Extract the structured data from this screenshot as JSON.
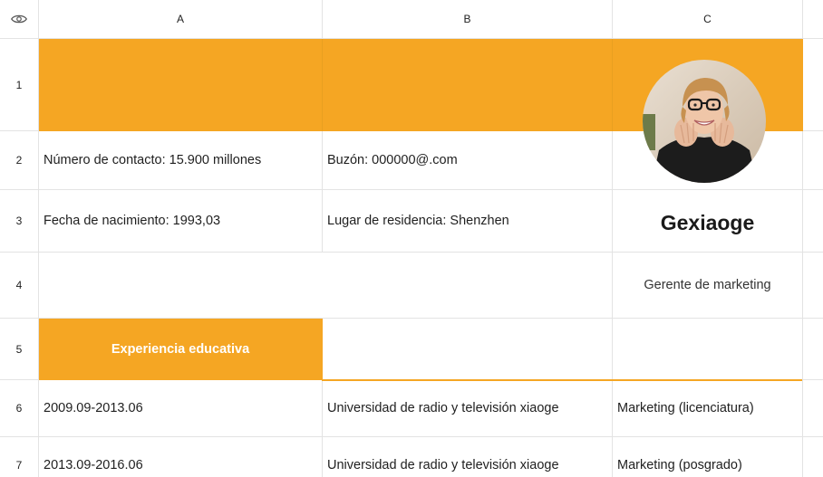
{
  "columns": [
    "A",
    "B",
    "C"
  ],
  "rows": [
    "1",
    "2",
    "3",
    "4",
    "5",
    "6",
    "7"
  ],
  "icons": {
    "visibility": "eye-icon"
  },
  "colors": {
    "accent": "#f5a623"
  },
  "cells": {
    "A2": "Número de contacto: 15.900 millones",
    "B2": "Buzón: 000000@.com",
    "A3": "Fecha de nacimiento: 1993,03",
    "B3": "Lugar de residencia: Shenzhen",
    "C3": "Gexiaoge",
    "C4": "Gerente de marketing",
    "A5": "Experiencia educativa",
    "A6": "2009.09-2013.06",
    "B6": "Universidad de radio y televisión xiaoge",
    "C6": "Marketing (licenciatura)",
    "A7": "2013.09-2016.06",
    "B7": "Universidad de radio y televisión xiaoge",
    "C7": "Marketing (posgrado)"
  }
}
